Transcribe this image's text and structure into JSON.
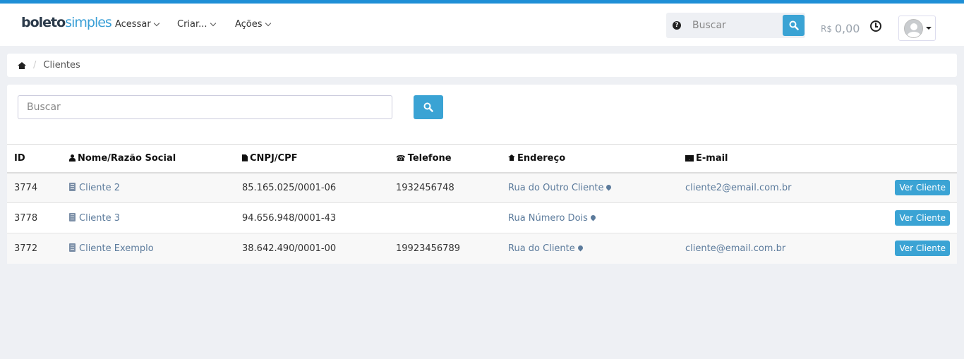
{
  "brand": {
    "part1": "boleto",
    "part2": "simples",
    "accent": "#1e8fd6",
    "button": "#3aa3d4"
  },
  "nav": {
    "menus": [
      {
        "label": "Acessar"
      },
      {
        "label": "Criar..."
      },
      {
        "label": "Ações"
      }
    ],
    "search_placeholder": "Buscar",
    "balance_currency": "R$",
    "balance_amount": "0,00"
  },
  "breadcrumb": {
    "current": "Clientes"
  },
  "list": {
    "search_placeholder": "Buscar",
    "columns": [
      "ID",
      "Nome/Razão Social",
      "CNPJ/CPF",
      "Telefone",
      "Endereço",
      "E-mail"
    ],
    "action_label": "Ver Cliente",
    "rows": [
      {
        "id": "3774",
        "name": "Cliente 2",
        "doc": "85.165.025/0001-06",
        "phone": "1932456748",
        "address": "Rua do Outro Cliente",
        "email": "cliente2@email.com.br"
      },
      {
        "id": "3778",
        "name": "Cliente 3",
        "doc": "94.656.948/0001-43",
        "phone": "",
        "address": "Rua Número Dois",
        "email": ""
      },
      {
        "id": "3772",
        "name": "Cliente Exemplo",
        "doc": "38.642.490/0001-00",
        "phone": "19923456789",
        "address": "Rua do Cliente",
        "email": "cliente@email.com.br"
      }
    ]
  }
}
